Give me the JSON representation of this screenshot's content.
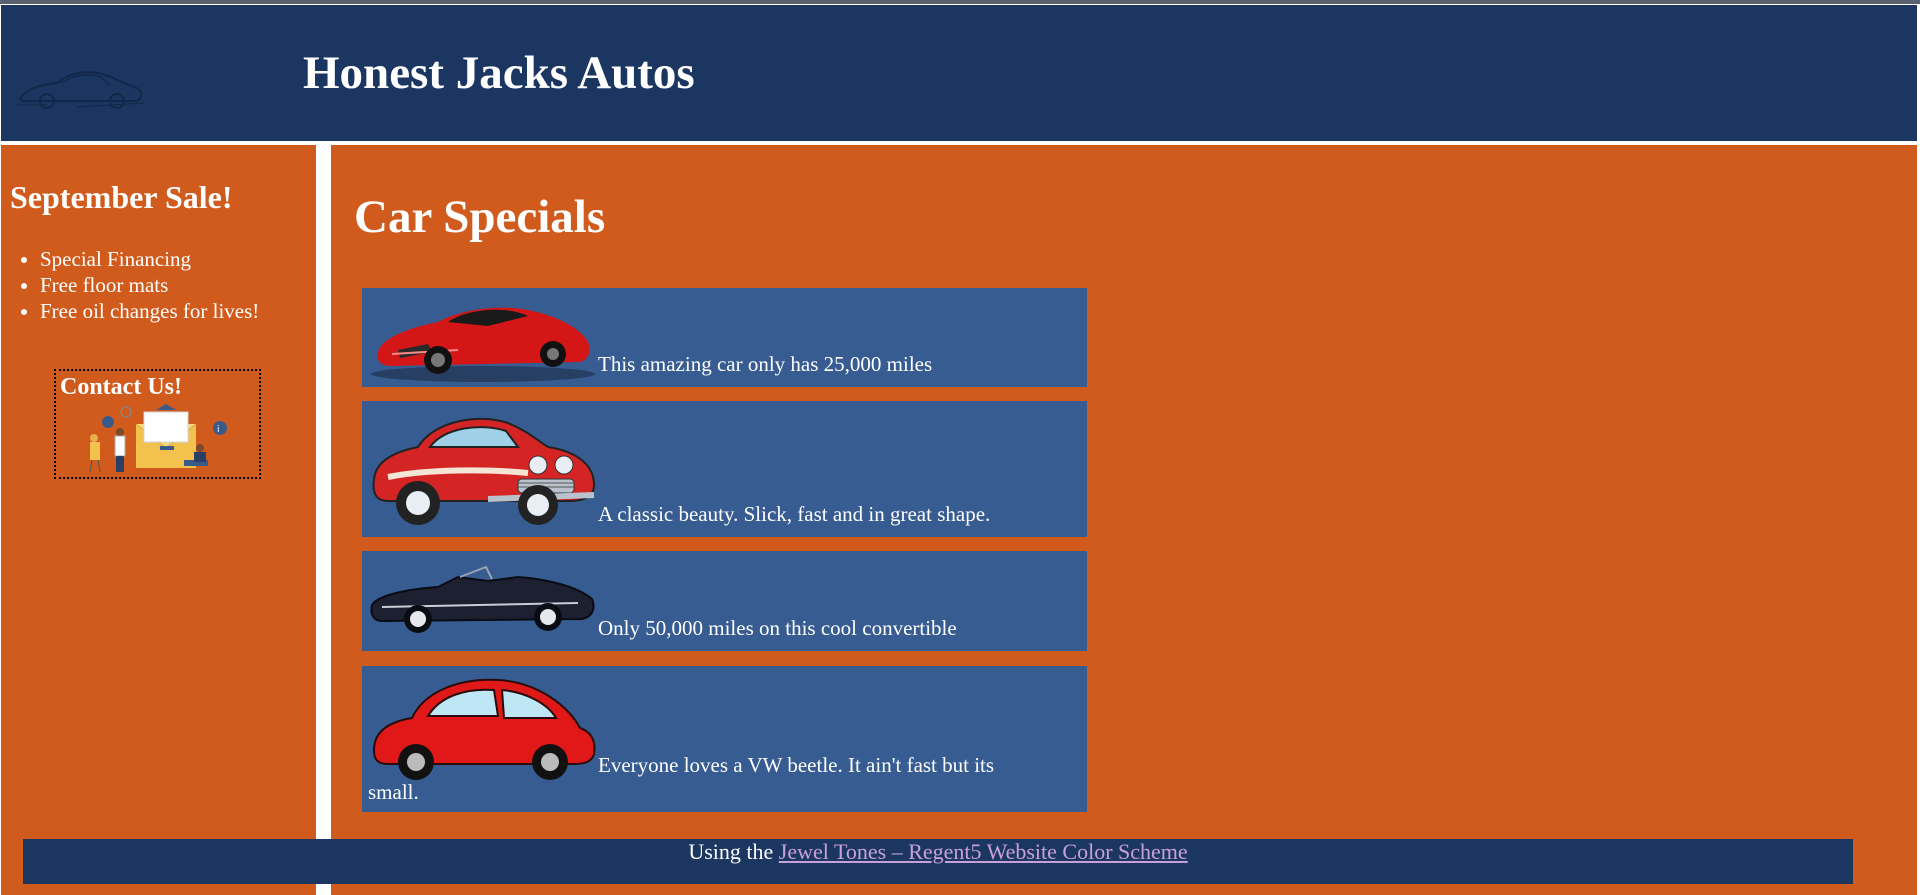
{
  "header": {
    "title": "Honest Jacks Autos"
  },
  "sidebar": {
    "heading": "September Sale!",
    "items": [
      "Special Financing",
      "Free floor mats",
      "Free oil changes for lives!"
    ],
    "contact_label": "Contact Us!"
  },
  "main": {
    "heading": "Car Specials",
    "cards": [
      {
        "text": "This amazing car only has 25,000 miles",
        "icon": "red-sports-car-icon"
      },
      {
        "text": "A classic beauty. Slick, fast and in great shape.",
        "icon": "classic-red-car-icon"
      },
      {
        "text": "Only 50,000 miles on this cool convertible",
        "icon": "black-convertible-icon"
      },
      {
        "text": "Everyone loves a VW beetle. It ain't fast but its small.",
        "icon": "red-beetle-icon"
      }
    ]
  },
  "footer": {
    "prefix": "Using the ",
    "link_text": "Jewel Tones – Regent5 Website Color Scheme"
  },
  "colors": {
    "header_bg": "#1b3660",
    "panel_bg": "#d15b1c",
    "card_bg": "#375c91",
    "link": "#c9a0d8"
  }
}
